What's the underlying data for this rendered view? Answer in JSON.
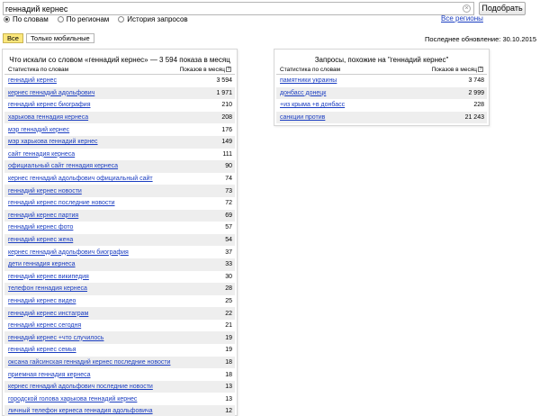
{
  "search": {
    "value": "геннадий кернес",
    "button_label": "Подобрать"
  },
  "modes": [
    {
      "label": "По словам",
      "selected": true
    },
    {
      "label": "По регионам",
      "selected": false
    },
    {
      "label": "История запросов",
      "selected": false
    }
  ],
  "regions_link": "Все регионы",
  "tabs": [
    {
      "label": "Все",
      "active": true
    },
    {
      "label": "Только мобильные",
      "active": false
    }
  ],
  "last_updated": "Последнее обновление: 30.10.2015",
  "left_panel": {
    "title": "Что искали со словом «геннадий кернес» — 3 594 показа в месяц",
    "col_query": "Статистика по словам",
    "col_count": "Показов в месяц",
    "rows": [
      {
        "query": "геннадий кернес",
        "count": "3 594"
      },
      {
        "query": "кернес геннадий адольфович",
        "count": "1 971"
      },
      {
        "query": "геннадий кернес биография",
        "count": "210"
      },
      {
        "query": "харькова геннадия кернеса",
        "count": "208"
      },
      {
        "query": "мэр геннадий кернес",
        "count": "176"
      },
      {
        "query": "мэр харькова геннадий кернес",
        "count": "149"
      },
      {
        "query": "сайт геннадия кернеса",
        "count": "111"
      },
      {
        "query": "официальный сайт геннадия кернеса",
        "count": "90"
      },
      {
        "query": "кернес геннадий адольфович официальный сайт",
        "count": "74"
      },
      {
        "query": "геннадий кернес новости",
        "count": "73"
      },
      {
        "query": "геннадий кернес последние новости",
        "count": "72"
      },
      {
        "query": "геннадий кернес партия",
        "count": "69"
      },
      {
        "query": "геннадий кернес фото",
        "count": "57"
      },
      {
        "query": "геннадий кернес жена",
        "count": "54"
      },
      {
        "query": "кернес геннадий адольфович биография",
        "count": "37"
      },
      {
        "query": "дети геннадия кернеса",
        "count": "33"
      },
      {
        "query": "геннадий кернес википедия",
        "count": "30"
      },
      {
        "query": "телефон геннадия кернеса",
        "count": "28"
      },
      {
        "query": "геннадий кернес видео",
        "count": "25"
      },
      {
        "query": "геннадий кернес инстаграм",
        "count": "22"
      },
      {
        "query": "геннадий кернес сегодня",
        "count": "21"
      },
      {
        "query": "геннадий кернес +что случилось",
        "count": "19"
      },
      {
        "query": "геннадий кернес семья",
        "count": "19"
      },
      {
        "query": "оксана гайсинская геннадий кернес последние новости",
        "count": "18"
      },
      {
        "query": "приемная геннадия кернеса",
        "count": "18"
      },
      {
        "query": "кернес геннадий адольфович последние новости",
        "count": "13"
      },
      {
        "query": "городской голова харькова геннадий кернес",
        "count": "13"
      },
      {
        "query": "личный телефон кернеса геннадия адольфовича",
        "count": "12"
      }
    ]
  },
  "right_panel": {
    "title": "Запросы, похожие на \"геннадий кернес\"",
    "col_query": "Статистика по словам",
    "col_count": "Показов в месяц",
    "rows": [
      {
        "query": "памятники украины",
        "count": "3 748"
      },
      {
        "query": "донбасс донецк",
        "count": "2 999"
      },
      {
        "query": "+из крыма +в донбасс",
        "count": "228"
      },
      {
        "query": "санкции против",
        "count": "21 243"
      }
    ]
  },
  "colors": {
    "link": "#1a3dc1",
    "active_tab": "#fbe77c",
    "row_stripe": "#eeeeee"
  }
}
